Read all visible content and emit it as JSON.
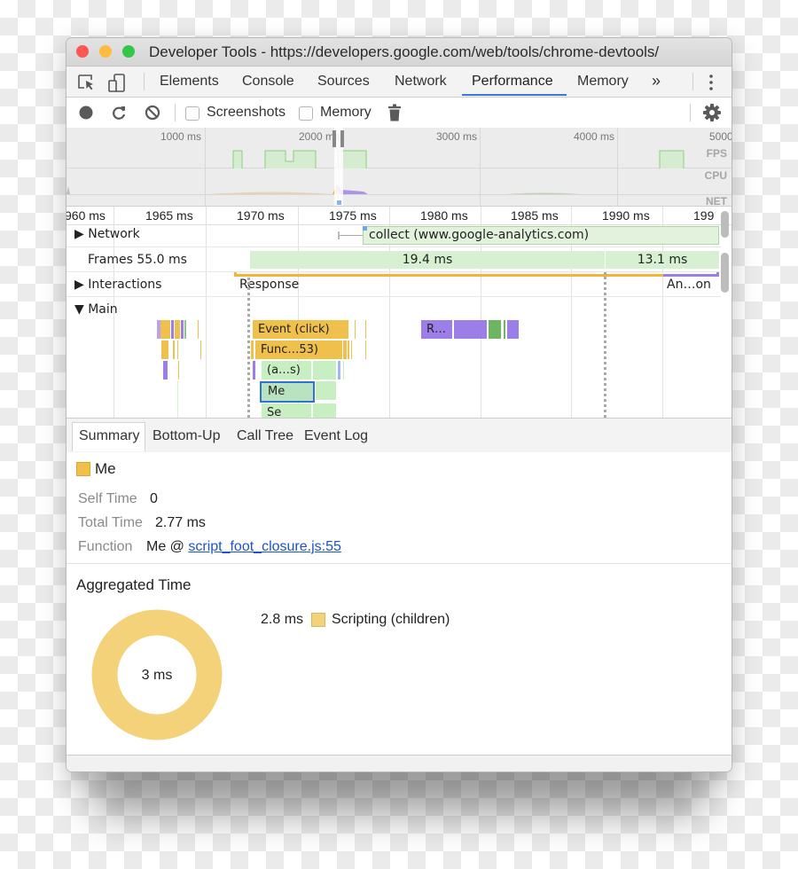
{
  "window": {
    "title": "Developer Tools - https://developers.google.com/web/tools/chrome-devtools/"
  },
  "tabbar": {
    "tabs": [
      {
        "label": "Elements",
        "active": false
      },
      {
        "label": "Console",
        "active": false
      },
      {
        "label": "Sources",
        "active": false
      },
      {
        "label": "Network",
        "active": false
      },
      {
        "label": "Performance",
        "active": true
      },
      {
        "label": "Memory",
        "active": false
      }
    ],
    "overflow_label": "»",
    "accent_color": "#3879d9"
  },
  "toolbar": {
    "screenshots_label": "Screenshots",
    "screenshots_checked": false,
    "memory_label": "Memory",
    "memory_checked": false
  },
  "overview": {
    "ticks": [
      "1000 ms",
      "2000 ms",
      "3000 ms",
      "4000 ms",
      "5000"
    ],
    "lanes": [
      "FPS",
      "CPU",
      "NET"
    ]
  },
  "timeline": {
    "ticks": [
      "960 ms",
      "1965 ms",
      "1970 ms",
      "1975 ms",
      "1980 ms",
      "1985 ms",
      "1990 ms",
      "199"
    ],
    "tracks": {
      "network": "Network",
      "frames": "Frames",
      "interactions": "Interactions",
      "main": "Main"
    },
    "network_request": "collect (www.google-analytics.com)",
    "frames": {
      "first": "55.0 ms",
      "second": "19.4 ms",
      "third": "13.1 ms"
    },
    "interactions": {
      "response": "Response",
      "animation": "An…on"
    },
    "main": {
      "event": "Event (click)",
      "function": "Func…53)",
      "anon": "(a…s)",
      "selected": "Me",
      "child": "Se",
      "render": "R…"
    },
    "colors": {
      "scripting": "#f0c04c",
      "rendering": "#9b7ee8",
      "painting": "#6cb663",
      "frame": "#d7f0d1",
      "selection": "#3879d9"
    }
  },
  "details": {
    "tabs": [
      {
        "label": "Summary",
        "active": true
      },
      {
        "label": "Bottom-Up",
        "active": false
      },
      {
        "label": "Call Tree",
        "active": false
      },
      {
        "label": "Event Log",
        "active": false
      }
    ],
    "summary": {
      "name": "Me",
      "self_time_label": "Self Time",
      "self_time": "0",
      "total_time_label": "Total Time",
      "total_time": "2.77 ms",
      "function_label": "Function",
      "function_prefix": "Me @ ",
      "function_link": "script_foot_closure.js:55"
    },
    "aggregated": {
      "title": "Aggregated Time",
      "total": "3 ms",
      "legend": [
        {
          "value": "2.8 ms",
          "label": "Scripting (children)",
          "color": "#f3d27a"
        }
      ]
    }
  }
}
